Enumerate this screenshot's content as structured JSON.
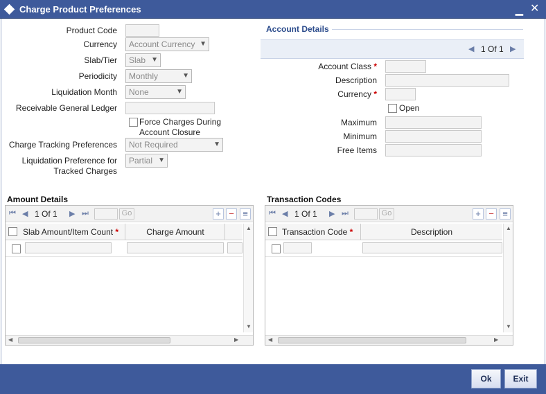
{
  "window": {
    "title": "Charge Product Preferences"
  },
  "form": {
    "product_code_label": "Product Code",
    "currency_label": "Currency",
    "currency_value": "Account Currency",
    "slab_tier_label": "Slab/Tier",
    "slab_tier_value": "Slab",
    "periodicity_label": "Periodicity",
    "periodicity_value": "Monthly",
    "liq_month_label": "Liquidation Month",
    "liq_month_value": "None",
    "rgl_label": "Receivable General Ledger",
    "force_charges_label_1": "Force Charges During",
    "force_charges_label_2": "Account Closure",
    "charge_tracking_label": "Charge Tracking Preferences",
    "charge_tracking_value": "Not Required",
    "liq_pref_label_1": "Liquidation Preference for",
    "liq_pref_label_2": "Tracked Charges",
    "liq_pref_value": "Partial"
  },
  "account_details": {
    "title": "Account Details",
    "pager": "1 Of 1",
    "account_class_label": "Account Class",
    "description_label": "Description",
    "currency_label": "Currency",
    "open_label": "Open",
    "maximum_label": "Maximum",
    "minimum_label": "Minimum",
    "free_items_label": "Free Items"
  },
  "amount_details": {
    "title": "Amount Details",
    "pager": "1 Of 1",
    "go_label": "Go",
    "columns": [
      "Slab Amount/Item Count",
      "Charge Amount"
    ]
  },
  "transaction_codes": {
    "title": "Transaction Codes",
    "pager": "1 Of 1",
    "go_label": "Go",
    "columns": [
      "Transaction Code",
      "Description"
    ]
  },
  "footer": {
    "ok_label": "Ok",
    "exit_label": "Exit"
  },
  "symbols": {
    "required": "*",
    "minimize": "▁",
    "close": "✕"
  }
}
